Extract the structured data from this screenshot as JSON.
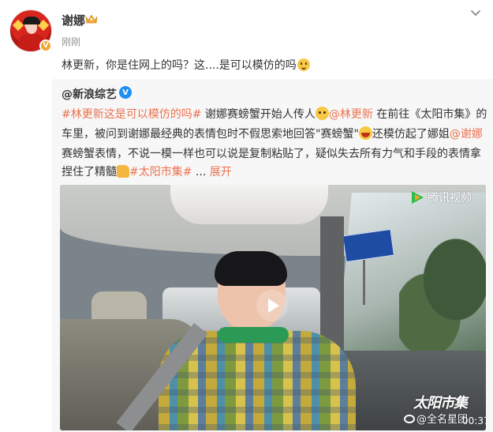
{
  "post": {
    "username": "谢娜",
    "timestamp": "刚刚",
    "text": "林更新，你是住网上的吗？这....是可以模仿的吗",
    "verified_badge": "V"
  },
  "repost": {
    "author": "@新浪综艺",
    "verified_badge": "V",
    "line1": {
      "tag": "#林更新这是可以模仿的吗#",
      "text_a": " 谢娜赛螃蟹开始人传人",
      "mention": "@林更新",
      "text_b": " 在前往《太阳市集》的"
    },
    "line2": {
      "text_a": "车里，被问到谢娜最经典的表情包时不假思索地回答\"赛螃蟹\"",
      "text_b": "还模仿起了娜姐",
      "mention": "@谢娜"
    },
    "line3": {
      "text": "赛螃蟹表情，不说一模一样也可以说是复制粘贴了，疑似失去所有力气和手段的表情拿"
    },
    "line4": {
      "text_a": "捏住了精髓",
      "tag": "#太阳市集#",
      "text_b": " ... ",
      "more": "展开"
    }
  },
  "video": {
    "platform_label": "腾讯视频",
    "show_logo": "太阳市集",
    "duration": "00:37"
  },
  "watermark": "@全名星团",
  "icons": {
    "crown": "crown-icon",
    "chevron": "chevron-down-icon",
    "play": "play-icon"
  },
  "colors": {
    "link": "#eb7350",
    "verified_blue": "#1d8ff4",
    "verified_gold": "#f2a530",
    "repost_bg": "#f7f7f7"
  }
}
